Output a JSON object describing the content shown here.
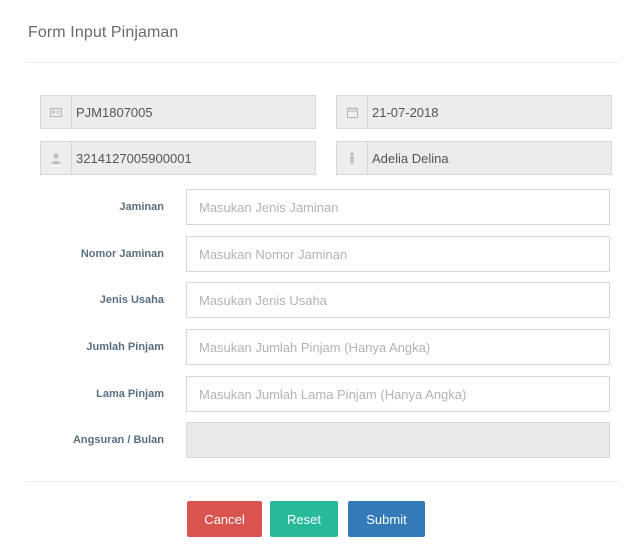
{
  "form": {
    "title": "Form Input Pinjaman"
  },
  "readonly": {
    "id": {
      "icon": "id-card-icon",
      "value": "PJM1807005"
    },
    "date": {
      "icon": "calendar-icon",
      "value": "21-07-2018"
    },
    "nik": {
      "icon": "user-icon",
      "value": "3214127005900001"
    },
    "name": {
      "icon": "person-icon",
      "value": "Adelia Delina"
    }
  },
  "fields": {
    "jaminan": {
      "label": "Jaminan",
      "placeholder": "Masukan Jenis Jaminan"
    },
    "nomor_jaminan": {
      "label": "Nomor Jaminan",
      "placeholder": "Masukan Nomor Jaminan"
    },
    "jenis_usaha": {
      "label": "Jenis Usaha",
      "placeholder": "Masukan Jenis Usaha"
    },
    "jumlah_pinjam": {
      "label": "Jumlah Pinjam",
      "placeholder": "Masukan Jumlah Pinjam (Hanya Angka)"
    },
    "lama_pinjam": {
      "label": "Lama Pinjam",
      "placeholder": "Masukan Jumlah Lama Pinjam (Hanya Angka)"
    },
    "angsuran": {
      "label": "Angsuran / Bulan",
      "placeholder": ""
    }
  },
  "buttons": {
    "cancel": "Cancel",
    "reset": "Reset",
    "submit": "Submit"
  },
  "colors": {
    "cancel": "#d9534f",
    "reset": "#26b99a",
    "submit": "#337ab7"
  }
}
